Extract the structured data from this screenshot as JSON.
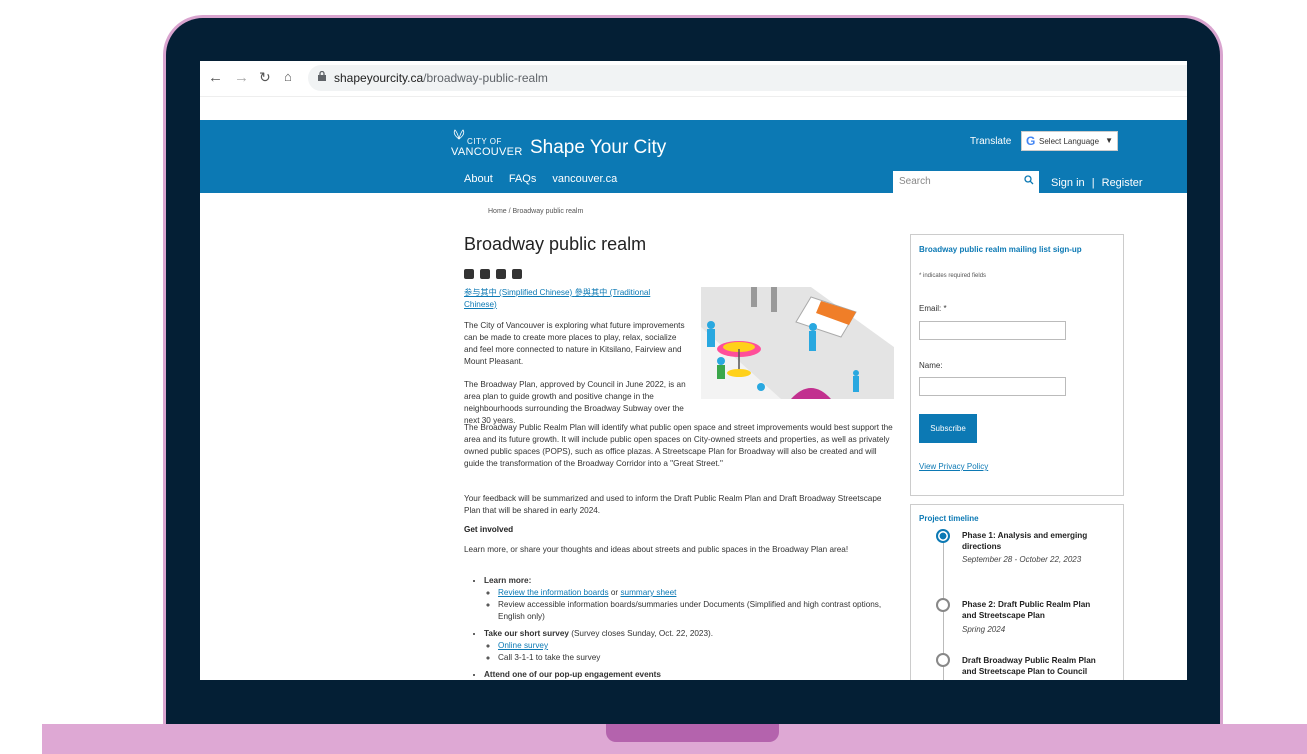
{
  "browser": {
    "url_host": "shapeyourcity.ca",
    "url_path": "/broadway-public-realm",
    "back_icon": "arrow-left-icon",
    "forward_icon": "arrow-right-icon",
    "reload_icon": "reload-icon",
    "home_icon": "home-icon"
  },
  "header": {
    "logo_small": "CITY OF",
    "logo_main": "VANCOUVER",
    "site_title": "Shape Your City",
    "translate_label": "Translate",
    "language_select": "Select Language",
    "nav": [
      "About",
      "FAQs",
      "vancouver.ca"
    ],
    "search_placeholder": "Search",
    "sign_in": "Sign in",
    "separator": "|",
    "register": "Register",
    "brand_color": "#0c79b4"
  },
  "breadcrumb": "Home / Broadway public realm",
  "page": {
    "title": "Broadway public realm",
    "share_icons": [
      "facebook-icon",
      "twitter-icon",
      "linkedin-icon",
      "email-icon"
    ],
    "lang_link_1": "参与其中 (Simplified Chinese)",
    "lang_link_2": "參與其中 (Traditional Chinese)",
    "para1": "The City of Vancouver is exploring what future improvements can be made to create more places to play, relax, socialize and feel more connected to nature in Kitsilano, Fairview and Mount Pleasant.",
    "para2": "The Broadway Plan, approved by Council in June 2022, is an area plan to guide growth and positive change in the neighbourhoods surrounding the Broadway Subway over the next 30 years.",
    "para3": "The Broadway Public Realm Plan will identify what public open space and street improvements would best support the area and its future growth. It will include public open spaces on City-owned streets and properties, as well as privately owned public spaces (POPS), such as office plazas. A Streetscape Plan for Broadway will also be created and will guide the transformation of the Broadway Corridor into a \"Great Street.\"",
    "para4": "Your feedback will be summarized and used to inform the Draft Public Realm Plan and Draft Broadway Streetscape Plan that will be shared in early 2024.",
    "get_involved_heading": "Get involved",
    "get_involved_text": "Learn more, or share your thoughts and ideas about streets and public spaces in the Broadway Plan area!",
    "learn_more_label": "Learn more:",
    "review_boards_link": "Review the information boards",
    "or_text": " or ",
    "summary_sheet_link": "summary sheet",
    "accessible_text": "Review accessible information boards/summaries under Documents (Simplified and high contrast options, English only)",
    "survey_label": "Take our short survey",
    "survey_closes": " (Survey closes Sunday, Oct. 22, 2023).",
    "online_survey_link": "Online survey",
    "call_text": "Call 3-1-1 to take the survey",
    "attend_label": "Attend one of our pop-up engagement events"
  },
  "signup": {
    "title": "Broadway public realm mailing list sign-up",
    "required_note": "* indicates required fields",
    "email_label": "Email: *",
    "name_label": "Name:",
    "subscribe": "Subscribe",
    "privacy_link": "View Privacy Policy"
  },
  "timeline": {
    "title": "Project timeline",
    "phases": [
      {
        "name": "Phase 1: Analysis and emerging directions",
        "date": "September 28 - October 22, 2023"
      },
      {
        "name": "Phase 2: Draft Public Realm Plan and Streetscape Plan",
        "date": "Spring 2024"
      },
      {
        "name": "Draft Broadway Public Realm Plan and Streetscape Plan to Council",
        "date": ""
      }
    ]
  }
}
